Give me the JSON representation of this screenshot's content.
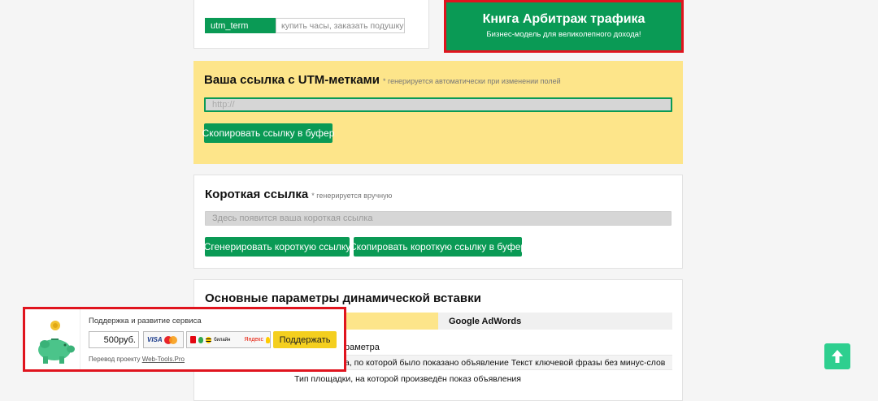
{
  "utm_term": {
    "tag": "utm_term",
    "value": "купить часы, заказать подушку"
  },
  "banner": {
    "title": "Книга Арбитраж трафика",
    "subtitle": "Бизнес-модель для великолепного дохода!"
  },
  "utm_link": {
    "title": "Ваша ссылка с UTM-метками",
    "hint": "* генерируется автоматически при изменении полей",
    "placeholder": "http://",
    "copy_button": "Скопировать ссылку в буфер"
  },
  "short_link": {
    "title": "Короткая ссылка",
    "hint": "* генерируется вручную",
    "placeholder": "Здесь появится ваша короткая ссылка",
    "generate_button": "Сгенерировать короткую ссылку",
    "copy_button": "Скопировать короткую ссылку в буфер"
  },
  "dynamic": {
    "title": "Основные параметры динамической вставки",
    "tab_google": "Google AdWords",
    "param_label": "раметра",
    "row1": "а, по которой было показано объявление Текст ключевой фразы без минус-слов",
    "row2": "Тип площадки, на которой произведён показ объявления"
  },
  "donate": {
    "title": "Поддержка и развитие сервиса",
    "amount": "500",
    "currency": "руб.",
    "pay_visa": "VISA",
    "pay_beeline": "билайн",
    "pay_yandex": "Яндекс",
    "button": "Поддержать",
    "footer_text": "Перевод проекту",
    "footer_link": "Web-Tools.Pro"
  },
  "colors": {
    "green": "#0a9a55",
    "yellow": "#fde58a",
    "red_frame": "#e0141e",
    "scroll_top": "#2ecf8f"
  },
  "icons": {
    "piggy": "piggy-bank-icon",
    "scroll_top": "arrow-up-icon"
  }
}
